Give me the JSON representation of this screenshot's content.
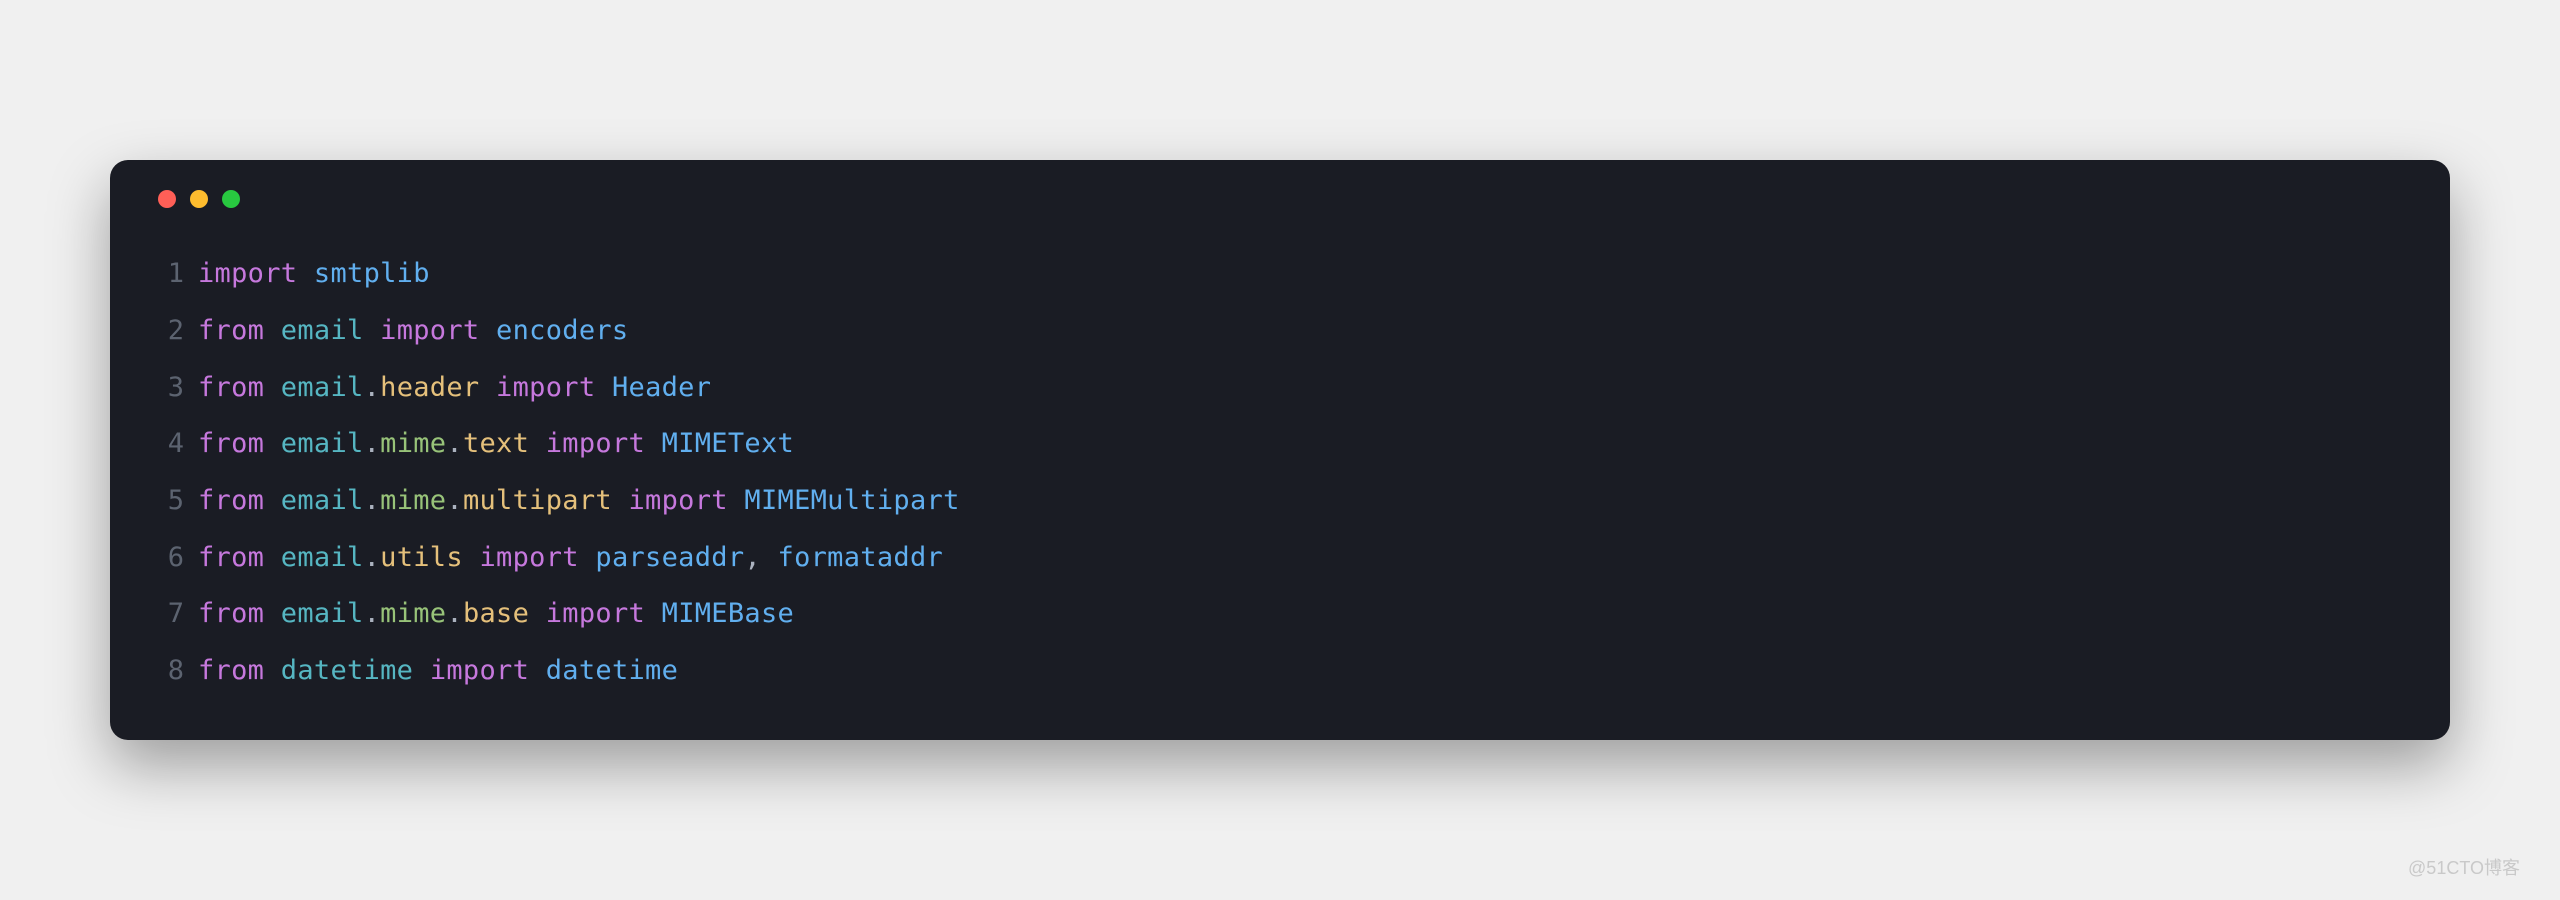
{
  "window": {
    "traffic_colors": {
      "red": "#ff5f57",
      "yellow": "#febc2e",
      "green": "#28c840"
    }
  },
  "code": {
    "lines": [
      {
        "num": "1",
        "tokens": [
          {
            "t": "import",
            "cls": "kw"
          },
          {
            "t": " ",
            "cls": "pun"
          },
          {
            "t": "smtplib",
            "cls": "cls"
          }
        ]
      },
      {
        "num": "2",
        "tokens": [
          {
            "t": "from",
            "cls": "kw"
          },
          {
            "t": " ",
            "cls": "pun"
          },
          {
            "t": "email",
            "cls": "mod"
          },
          {
            "t": " ",
            "cls": "pun"
          },
          {
            "t": "import",
            "cls": "kw"
          },
          {
            "t": " ",
            "cls": "pun"
          },
          {
            "t": "encoders",
            "cls": "cls"
          }
        ]
      },
      {
        "num": "3",
        "tokens": [
          {
            "t": "from",
            "cls": "kw"
          },
          {
            "t": " ",
            "cls": "pun"
          },
          {
            "t": "email",
            "cls": "mod"
          },
          {
            "t": ".",
            "cls": "pun"
          },
          {
            "t": "header",
            "cls": "sub"
          },
          {
            "t": " ",
            "cls": "pun"
          },
          {
            "t": "import",
            "cls": "kw"
          },
          {
            "t": " ",
            "cls": "pun"
          },
          {
            "t": "Header",
            "cls": "cls"
          }
        ]
      },
      {
        "num": "4",
        "tokens": [
          {
            "t": "from",
            "cls": "kw"
          },
          {
            "t": " ",
            "cls": "pun"
          },
          {
            "t": "email",
            "cls": "mod"
          },
          {
            "t": ".",
            "cls": "pun"
          },
          {
            "t": "mime",
            "cls": "mime"
          },
          {
            "t": ".",
            "cls": "pun"
          },
          {
            "t": "text",
            "cls": "sub"
          },
          {
            "t": " ",
            "cls": "pun"
          },
          {
            "t": "import",
            "cls": "kw"
          },
          {
            "t": " ",
            "cls": "pun"
          },
          {
            "t": "MIMEText",
            "cls": "cls"
          }
        ]
      },
      {
        "num": "5",
        "tokens": [
          {
            "t": "from",
            "cls": "kw"
          },
          {
            "t": " ",
            "cls": "pun"
          },
          {
            "t": "email",
            "cls": "mod"
          },
          {
            "t": ".",
            "cls": "pun"
          },
          {
            "t": "mime",
            "cls": "mime"
          },
          {
            "t": ".",
            "cls": "pun"
          },
          {
            "t": "multipart",
            "cls": "sub"
          },
          {
            "t": " ",
            "cls": "pun"
          },
          {
            "t": "import",
            "cls": "kw"
          },
          {
            "t": " ",
            "cls": "pun"
          },
          {
            "t": "MIMEMultipart",
            "cls": "cls"
          }
        ]
      },
      {
        "num": "6",
        "tokens": [
          {
            "t": "from",
            "cls": "kw"
          },
          {
            "t": " ",
            "cls": "pun"
          },
          {
            "t": "email",
            "cls": "mod"
          },
          {
            "t": ".",
            "cls": "pun"
          },
          {
            "t": "utils",
            "cls": "sub"
          },
          {
            "t": " ",
            "cls": "pun"
          },
          {
            "t": "import",
            "cls": "kw"
          },
          {
            "t": " ",
            "cls": "pun"
          },
          {
            "t": "parseaddr",
            "cls": "cls"
          },
          {
            "t": ",",
            "cls": "pun"
          },
          {
            "t": " ",
            "cls": "pun"
          },
          {
            "t": "formataddr",
            "cls": "cls"
          }
        ]
      },
      {
        "num": "7",
        "tokens": [
          {
            "t": "from",
            "cls": "kw"
          },
          {
            "t": " ",
            "cls": "pun"
          },
          {
            "t": "email",
            "cls": "mod"
          },
          {
            "t": ".",
            "cls": "pun"
          },
          {
            "t": "mime",
            "cls": "mime"
          },
          {
            "t": ".",
            "cls": "pun"
          },
          {
            "t": "base",
            "cls": "sub"
          },
          {
            "t": " ",
            "cls": "pun"
          },
          {
            "t": "import",
            "cls": "kw"
          },
          {
            "t": " ",
            "cls": "pun"
          },
          {
            "t": "MIMEBase",
            "cls": "cls"
          }
        ]
      },
      {
        "num": "8",
        "tokens": [
          {
            "t": "from",
            "cls": "kw"
          },
          {
            "t": " ",
            "cls": "pun"
          },
          {
            "t": "datetime",
            "cls": "mod"
          },
          {
            "t": " ",
            "cls": "pun"
          },
          {
            "t": "import",
            "cls": "kw"
          },
          {
            "t": " ",
            "cls": "pun"
          },
          {
            "t": "datetime",
            "cls": "cls"
          }
        ]
      }
    ]
  },
  "watermark": "@51CTO博客"
}
